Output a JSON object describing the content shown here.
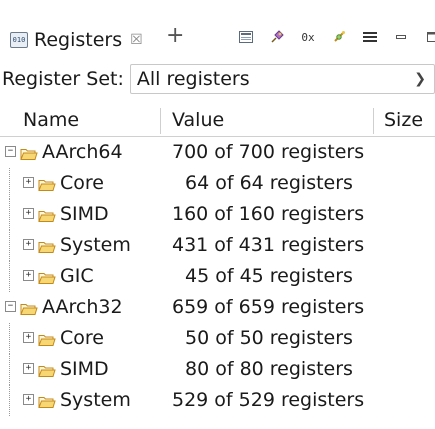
{
  "tab": {
    "icon_text": "010",
    "title": "Registers",
    "close_glyph": "☒",
    "plus_glyph": "+"
  },
  "toolbar": {
    "hex_label": "0x",
    "icons": [
      "layout-icon",
      "pin-icon",
      "hex-format-icon",
      "link-icon",
      "menu-icon",
      "minimize-icon",
      "maximize-icon"
    ]
  },
  "register_set": {
    "label": "Register Set:",
    "selected": "All registers"
  },
  "columns": {
    "name": "Name",
    "value": "Value",
    "size": "Size"
  },
  "rows": [
    {
      "name": "AArch64",
      "value": "700 of 700 registers",
      "level": 0
    },
    {
      "name": "Core",
      "value": "64 of 64 registers",
      "level": 1
    },
    {
      "name": "SIMD",
      "value": "160 of 160 registers",
      "level": 1
    },
    {
      "name": "System",
      "value": "431 of 431 registers",
      "level": 1
    },
    {
      "name": "GIC",
      "value": "45 of 45 registers",
      "level": 1
    },
    {
      "name": "AArch32",
      "value": "659 of 659 registers",
      "level": 0
    },
    {
      "name": "Core",
      "value": "50 of 50 registers",
      "level": 1
    },
    {
      "name": "SIMD",
      "value": "80 of 80 registers",
      "level": 1
    },
    {
      "name": "System",
      "value": "529 of 529 registers",
      "level": 1
    }
  ],
  "colors": {
    "folder_stroke": "#c48a18",
    "folder_fill": "#f7d774",
    "border": "#c8c8c8"
  }
}
